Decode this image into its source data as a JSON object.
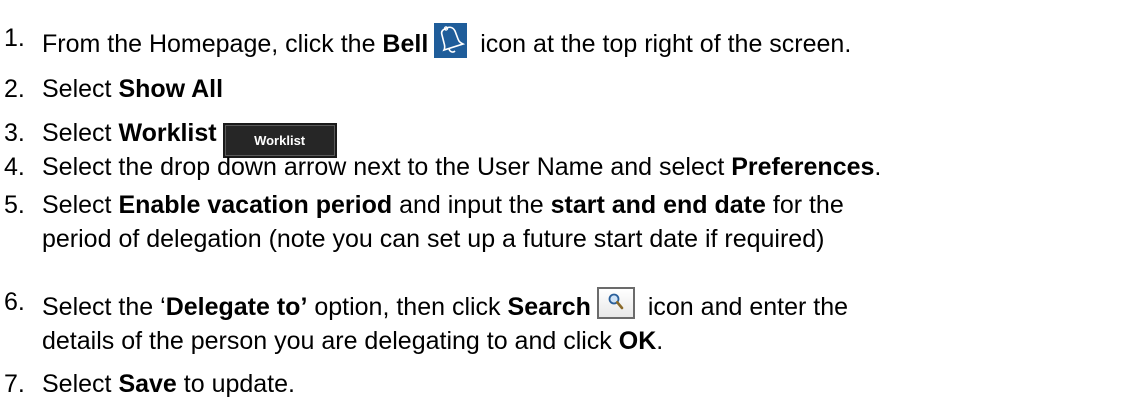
{
  "steps": [
    {
      "number": "1.",
      "t1": "From the Homepage, click the ",
      "b1": "Bell",
      "icon": "bell-icon",
      "t2": " icon at the top right of the screen."
    },
    {
      "number": "2.",
      "t1": "Select ",
      "b1": "Show All"
    },
    {
      "number": "3.",
      "t1": "Select ",
      "b1": "Worklist",
      "button_label": "Worklist"
    },
    {
      "number": "4.",
      "t1": "Select the drop down arrow next to the User Name and select ",
      "b1": "Preferences",
      "t2": "."
    },
    {
      "number": "5.",
      "t1": "Select ",
      "b1": "Enable vacation period",
      "t2": " and input the ",
      "b2": "start and end date",
      "t3": " for the",
      "line2": "period of delegation (note you can set up a future start date if required)"
    },
    {
      "number": "6.",
      "t1": "Select the ‘",
      "b1": "Delegate to’",
      "t2": " option, then click ",
      "b2": "Search",
      "icon": "search-icon",
      "t3": " icon and enter the",
      "line2_t1": "details of the person you are delegating to and click ",
      "line2_b1": "OK",
      "line2_t2": "."
    },
    {
      "number": "7.",
      "t1": "Select ",
      "b1": "Save",
      "t2": " to update."
    }
  ],
  "colors": {
    "bell_icon_bg": "#1f5d9a",
    "worklist_button_bg": "#262626",
    "text": "#000000"
  }
}
